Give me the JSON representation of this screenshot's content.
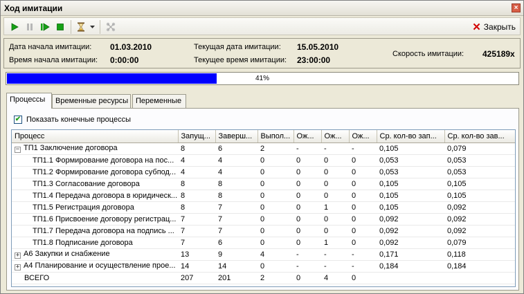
{
  "window": {
    "title": "Ход имитации"
  },
  "toolbar": {
    "close_label": "Закрыть"
  },
  "info": {
    "start_date_label": "Дата начала имитации:",
    "start_date_value": "01.03.2010",
    "start_time_label": "Время начала имитации:",
    "start_time_value": "0:00:00",
    "current_date_label": "Текущая дата имитации:",
    "current_date_value": "15.05.2010",
    "current_time_label": "Текущее время имитации:",
    "current_time_value": "23:00:00",
    "speed_label": "Скорость имитации:",
    "speed_value": "425189x"
  },
  "progress": {
    "value": 0.41,
    "text": "41%"
  },
  "tabs": [
    "Процессы",
    "Временные ресурсы",
    "Переменные"
  ],
  "panel": {
    "show_final_label": "Показать конечные процессы",
    "show_final_checked": true
  },
  "table": {
    "columns": [
      "Процесс",
      "Запущ...",
      "Заверш...",
      "Выпол...",
      "Ож...",
      "Ож...",
      "Ож...",
      "Ср. кол-во зап...",
      "Ср. кол-во зав..."
    ],
    "rows": [
      {
        "name": "ТП1 Заключение договора",
        "expander": "−",
        "level": 0,
        "cells": [
          "8",
          "6",
          "2",
          "-",
          "-",
          "-",
          "0,105",
          "0,079"
        ]
      },
      {
        "name": "ТП1.1 Формирование договора на пос...",
        "expander": "",
        "level": 1,
        "cells": [
          "4",
          "4",
          "0",
          "0",
          "0",
          "0",
          "0,053",
          "0,053"
        ]
      },
      {
        "name": "ТП1.2 Формирование договора субпод...",
        "expander": "",
        "level": 1,
        "cells": [
          "4",
          "4",
          "0",
          "0",
          "0",
          "0",
          "0,053",
          "0,053"
        ]
      },
      {
        "name": "ТП1.3 Согласование договора",
        "expander": "",
        "level": 1,
        "cells": [
          "8",
          "8",
          "0",
          "0",
          "0",
          "0",
          "0,105",
          "0,105"
        ]
      },
      {
        "name": "ТП1.4 Передача договора в юридическ...",
        "expander": "",
        "level": 1,
        "cells": [
          "8",
          "8",
          "0",
          "0",
          "0",
          "0",
          "0,105",
          "0,105"
        ]
      },
      {
        "name": "ТП1.5 Регистрация договора",
        "expander": "",
        "level": 1,
        "cells": [
          "8",
          "7",
          "0",
          "0",
          "1",
          "0",
          "0,105",
          "0,092"
        ]
      },
      {
        "name": "ТП1.6 Присвоение договору регистрац...",
        "expander": "",
        "level": 1,
        "cells": [
          "7",
          "7",
          "0",
          "0",
          "0",
          "0",
          "0,092",
          "0,092"
        ]
      },
      {
        "name": "ТП1.7 Передача договора на подпись ...",
        "expander": "",
        "level": 1,
        "cells": [
          "7",
          "7",
          "0",
          "0",
          "0",
          "0",
          "0,092",
          "0,092"
        ]
      },
      {
        "name": "ТП1.8 Подписание договора",
        "expander": "",
        "level": 1,
        "cells": [
          "7",
          "6",
          "0",
          "0",
          "1",
          "0",
          "0,092",
          "0,079"
        ]
      },
      {
        "name": "А6 Закупки и снабжение",
        "expander": "+",
        "level": 0,
        "cells": [
          "13",
          "9",
          "4",
          "-",
          "-",
          "-",
          "0,171",
          "0,118"
        ]
      },
      {
        "name": "А4 Планирование и осуществление прое...",
        "expander": "+",
        "level": 0,
        "cells": [
          "14",
          "14",
          "0",
          "-",
          "-",
          "-",
          "0,184",
          "0,184"
        ]
      },
      {
        "name": "ВСЕГО",
        "expander": "",
        "level": 0,
        "cells": [
          "207",
          "201",
          "2",
          "0",
          "4",
          "0",
          "",
          ""
        ]
      }
    ]
  }
}
